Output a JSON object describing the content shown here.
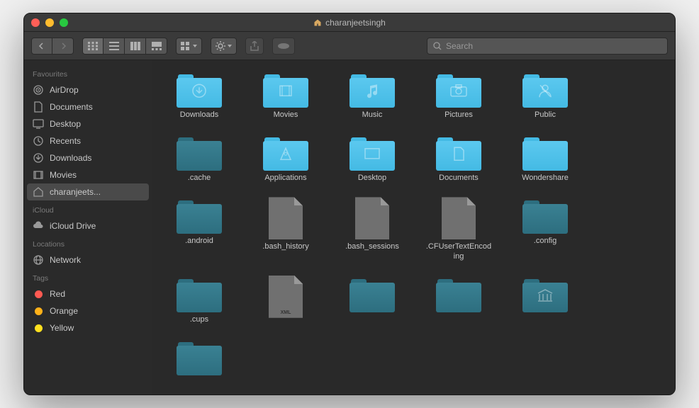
{
  "window": {
    "title": "charanjeetsingh"
  },
  "search": {
    "placeholder": "Search"
  },
  "colors": {
    "folder_primary": "#44bae4",
    "folder_light": "#5bc8ef",
    "folder_muted": "#2d6e7f",
    "folder_muted_light": "#3a8193",
    "tag_red": "#ff5a52",
    "tag_orange": "#ffb119",
    "tag_yellow": "#ffe01f"
  },
  "sidebar": {
    "sections": [
      {
        "title": "Favourites",
        "items": [
          {
            "label": "AirDrop",
            "icon": "airdrop"
          },
          {
            "label": "Documents",
            "icon": "documents"
          },
          {
            "label": "Desktop",
            "icon": "desktop"
          },
          {
            "label": "Recents",
            "icon": "recents"
          },
          {
            "label": "Downloads",
            "icon": "downloads"
          },
          {
            "label": "Movies",
            "icon": "movies"
          },
          {
            "label": "charanjeets...",
            "icon": "home",
            "selected": true
          }
        ]
      },
      {
        "title": "iCloud",
        "items": [
          {
            "label": "iCloud Drive",
            "icon": "cloud"
          }
        ]
      },
      {
        "title": "Locations",
        "items": [
          {
            "label": "Network",
            "icon": "network"
          }
        ]
      },
      {
        "title": "Tags",
        "items": [
          {
            "label": "Red",
            "icon": "tag",
            "color": "#ff5a52"
          },
          {
            "label": "Orange",
            "icon": "tag",
            "color": "#ffb119"
          },
          {
            "label": "Yellow",
            "icon": "tag",
            "color": "#ffe01f"
          }
        ]
      }
    ]
  },
  "items": [
    {
      "label": "Downloads",
      "type": "folder",
      "glyph": "download",
      "variant": "bright"
    },
    {
      "label": "Movies",
      "type": "folder",
      "glyph": "movie",
      "variant": "bright"
    },
    {
      "label": "Music",
      "type": "folder",
      "glyph": "music",
      "variant": "bright"
    },
    {
      "label": "Pictures",
      "type": "folder",
      "glyph": "camera",
      "variant": "bright"
    },
    {
      "label": "Public",
      "type": "folder",
      "glyph": "person",
      "variant": "bright"
    },
    {
      "label": ".cache",
      "type": "folder",
      "glyph": "",
      "variant": "muted"
    },
    {
      "label": "Applications",
      "type": "folder",
      "glyph": "a-shape",
      "variant": "bright"
    },
    {
      "label": "Desktop",
      "type": "folder",
      "glyph": "desktop-rect",
      "variant": "bright"
    },
    {
      "label": "Documents",
      "type": "folder",
      "glyph": "doc",
      "variant": "bright"
    },
    {
      "label": "Wondershare",
      "type": "folder",
      "glyph": "",
      "variant": "bright"
    },
    {
      "label": ".android",
      "type": "folder",
      "glyph": "",
      "variant": "muted"
    },
    {
      "label": ".bash_history",
      "type": "file",
      "ext": ""
    },
    {
      "label": ".bash_sessions",
      "type": "file",
      "ext": ""
    },
    {
      "label": ".CFUserTextEncoding",
      "type": "file",
      "ext": ""
    },
    {
      "label": ".config",
      "type": "folder",
      "glyph": "",
      "variant": "muted"
    },
    {
      "label": ".cups",
      "type": "folder",
      "glyph": "",
      "variant": "muted"
    },
    {
      "label": "",
      "type": "file",
      "ext": "XML"
    },
    {
      "label": "",
      "type": "folder",
      "glyph": "",
      "variant": "muted"
    },
    {
      "label": "",
      "type": "folder",
      "glyph": "",
      "variant": "muted"
    },
    {
      "label": "",
      "type": "folder",
      "glyph": "library",
      "variant": "muted"
    },
    {
      "label": "",
      "type": "folder",
      "glyph": "",
      "variant": "muted"
    }
  ]
}
